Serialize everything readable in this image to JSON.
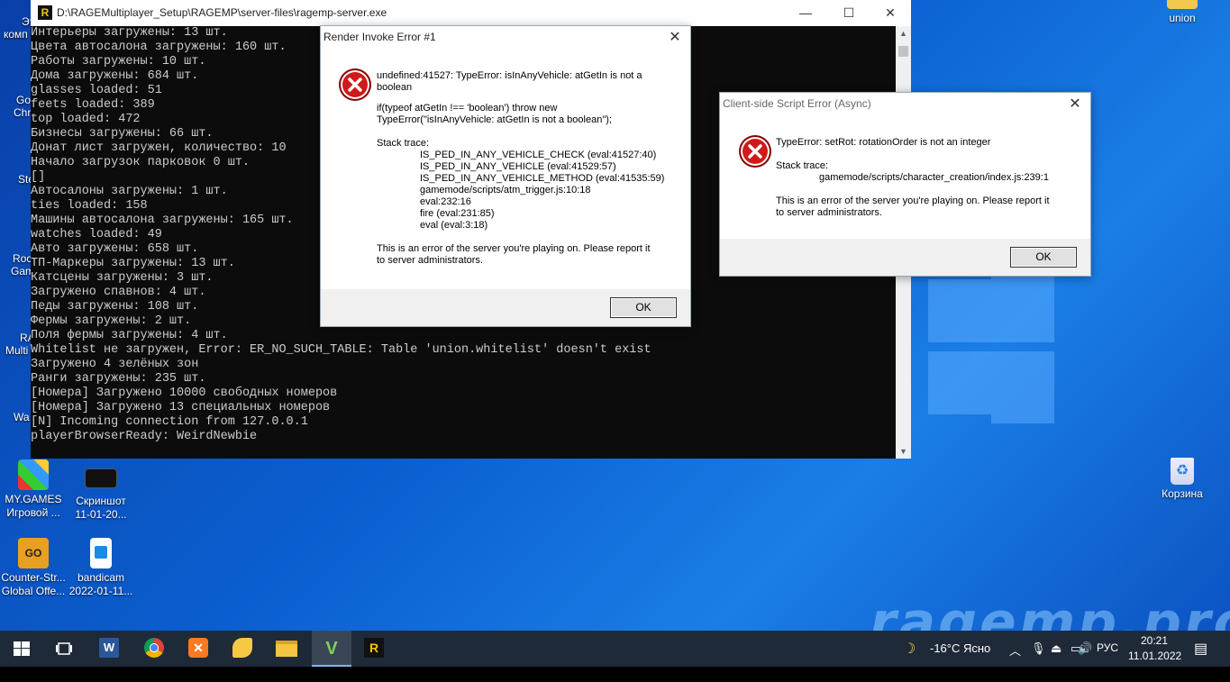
{
  "desktop": {
    "icons_left": [
      {
        "label1": "MY.GAMES",
        "label2": "Игровой ..."
      },
      {
        "label1": "Скриншот",
        "label2": "11-01-20..."
      },
      {
        "label1": "Counter-Str...",
        "label2": "Global Offe..."
      },
      {
        "label1": "bandicam",
        "label2": "2022-01-11..."
      }
    ],
    "partial_left": [
      "Эт",
      "комп",
      "Go",
      "Chr",
      "Ste",
      "Roc",
      "Gam",
      "RA",
      "Multi",
      "Wa"
    ],
    "icon_union": "union",
    "icon_recycle": "Корзина",
    "watermark": "ragemp.pro"
  },
  "console": {
    "title": "D:\\RAGEMultiplayer_Setup\\RAGEMP\\server-files\\ragemp-server.exe",
    "controls": [
      "—",
      "☐",
      "✕"
    ],
    "lines": [
      "Интерьеры загружены: 13 шт.",
      "Цвета автосалона загружены: 160 шт.",
      "Работы загружены: 10 шт.",
      "Дома загружены: 684 шт.",
      "glasses loaded: 51",
      "feets loaded: 389",
      "top loaded: 472",
      "Бизнесы загружены: 66 шт.",
      "Донат лист загружен, количество: 10",
      "Начало загрузок парковок 0 шт.",
      "[]",
      "Автосалоны загружены: 1 шт.",
      "ties loaded: 158",
      "Машины автосалона загружены: 165 шт.",
      "watches loaded: 49",
      "Авто загружены: 658 шт.",
      "ТП-Маркеры загружены: 13 шт.",
      "Катсцены загружены: 3 шт.",
      "Загружено спавнов: 4 шт.",
      "Педы загружены: 108 шт.",
      "Фермы загружены: 2 шт.",
      "Поля фермы загружены: 4 шт.",
      "Whitelist не загружен, Error: ER_NO_SUCH_TABLE: Table 'union.whitelist' doesn't exist",
      "Загружено 4 зелёных зон",
      "Ранги загружены: 235 шт.",
      "[Номера] Загружено 10000 свободных номеров",
      "[Номера] Загружено 13 специальных номеров",
      "[N] Incoming connection from 127.0.0.1",
      "playerBrowserReady: WeirdNewbie"
    ]
  },
  "dialog1": {
    "title": "Render Invoke Error #1",
    "close": "✕",
    "message": "undefined:41527: TypeError: isInAnyVehicle: atGetIn is not a\nboolean",
    "code": "if(typeof atGetIn !== 'boolean') throw new\nTypeError(\"isInAnyVehicle: atGetIn is not a boolean\");",
    "stack_label": "Stack trace:",
    "stack": [
      "IS_PED_IN_ANY_VEHICLE_CHECK (eval:41527:40)",
      "IS_PED_IN_ANY_VEHICLE (eval:41529:57)",
      "IS_PED_IN_ANY_VEHICLE_METHOD (eval:41535:59)",
      "gamemode/scripts/atm_trigger.js:10:18",
      "eval:232:16",
      "fire (eval:231:85)",
      "eval (eval:3:18)"
    ],
    "footer_note": "This is an error of the server you're playing on. Please report it\nto server administrators.",
    "ok": "OK"
  },
  "dialog2": {
    "title": "Client-side Script Error (Async)",
    "close": "✕",
    "message": "TypeError: setRot: rotationOrder is not an integer",
    "stack_label": "Stack trace:",
    "stack": [
      "gamemode/scripts/character_creation/index.js:239:1"
    ],
    "footer_note": "This is an error of the server you're playing on. Please report it\nto server administrators.",
    "ok": "OK"
  },
  "taskbar": {
    "weather": "-16°C Ясно",
    "lang": "РУС",
    "time": "20:21",
    "date": "11.01.2022"
  }
}
